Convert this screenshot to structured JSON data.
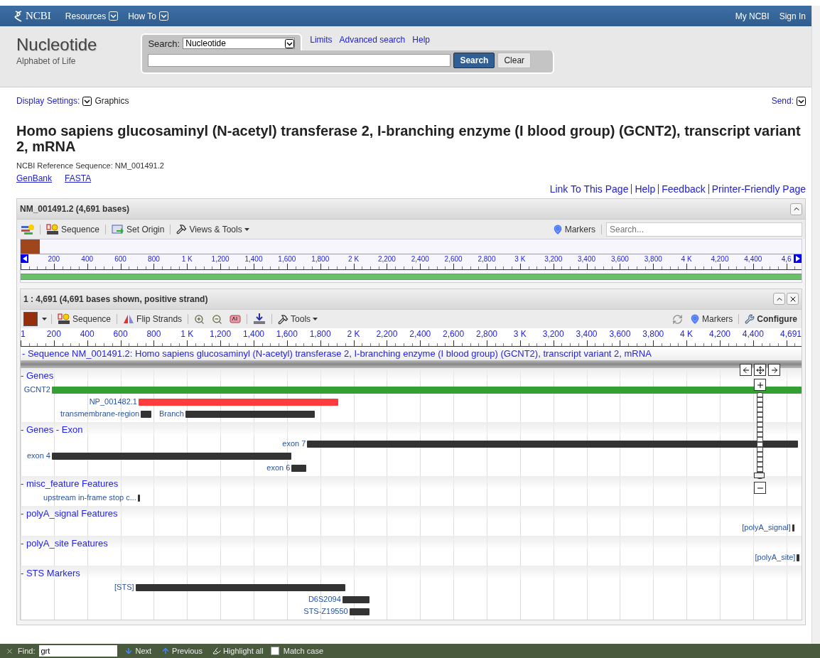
{
  "header": {
    "logo": "NCBI",
    "menus": [
      {
        "label": "Resources"
      },
      {
        "label": "How To"
      }
    ],
    "account_links": [
      "My NCBI",
      "Sign In"
    ]
  },
  "search": {
    "database_title": "Nucleotide",
    "tagline": "Alphabet of Life",
    "label": "Search:",
    "database": "Nucleotide",
    "links": [
      "Limits",
      "Advanced search",
      "Help"
    ],
    "search_button": "Search",
    "clear_button": "Clear"
  },
  "display": {
    "settings_label": "Display Settings:",
    "format": "Graphics",
    "send_label": "Send:"
  },
  "record": {
    "title": "Homo sapiens glucosaminyl (N-acetyl) transferase 2, I-branching enzyme (I blood group) (GCNT2), transcript variant 2, mRNA",
    "refseq": "NCBI Reference Sequence: NM_001491.2",
    "format_links": [
      "GenBank",
      "FASTA"
    ],
    "page_links": [
      "Link To This Page",
      "Help",
      "Feedback",
      "Printer-Friendly Page"
    ]
  },
  "viewer": {
    "title": "NM_001491.2 (4,691 bases)",
    "toolbar": {
      "sequence": "Sequence",
      "set_origin": "Set Origin",
      "views_tools": "Views & Tools",
      "markers": "Markers",
      "search_placeholder": "Search..."
    },
    "overview_ticks": [
      "200",
      "400",
      "600",
      "800",
      "1 K",
      "1,200",
      "1,400",
      "1,600",
      "1,800",
      "2 K",
      "2,200",
      "2,400",
      "2,600",
      "2,800",
      "3 K",
      "3,200",
      "3,400",
      "3,600",
      "3,800",
      "4 K",
      "4,200",
      "4,400",
      "4,6"
    ],
    "panel": {
      "title": "1 : 4,691 (4,691 bases shown, positive strand)",
      "toolbar": {
        "sequence": "Sequence",
        "flip_strands": "Flip Strands",
        "tools": "Tools",
        "markers": "Markers",
        "configure": "Configure"
      },
      "ruler_ticks": [
        "1",
        "200",
        "400",
        "600",
        "800",
        "1 K",
        "1,200",
        "1,400",
        "1,600",
        "1,800",
        "2 K",
        "2,200",
        "2,400",
        "2,600",
        "2,800",
        "3 K",
        "3,200",
        "3,400",
        "3,600",
        "3,800",
        "4 K",
        "4,200",
        "4,400",
        "4,691"
      ],
      "sequence_title": "- Sequence NM_001491.2: Homo sapiens glucosaminyl (N-acetyl) transferase 2, I-branching enzyme (I blood group) (GCNT2), transcript variant 2, mRNA",
      "zoom_slider": {
        "level": 0
      },
      "tracks": [
        {
          "title": "- Genes",
          "rows": [
            [
              {
                "label": "GCNT2",
                "color": "#33a033"
              }
            ],
            [
              {
                "label": "NP_001482.1",
                "color": "#ff3b3b"
              }
            ],
            [
              {
                "label": "transmembrane-region",
                "color": "#333333"
              },
              {
                "label": "Branch",
                "color": "#333333"
              }
            ]
          ]
        },
        {
          "title": "- Genes - Exon",
          "rows": [
            [
              {
                "label": "exon 7",
                "color": "#333333"
              }
            ],
            [
              {
                "label": "exon 4",
                "color": "#333333"
              }
            ],
            [
              {
                "label": "exon 6",
                "color": "#333333"
              }
            ]
          ]
        },
        {
          "title": "- misc_feature Features",
          "rows": [
            [
              {
                "label": "upstream in-frame stop c...",
                "color": "#333333"
              }
            ]
          ]
        },
        {
          "title": "- polyA_signal Features",
          "rows": [
            [
              {
                "label": "[polyA_signal]",
                "color": "#333333"
              }
            ]
          ]
        },
        {
          "title": "- polyA_site Features",
          "rows": [
            [
              {
                "label": "[polyA_site]",
                "color": "#333333"
              }
            ]
          ]
        },
        {
          "title": "- STS Markers",
          "rows": [
            [
              {
                "label": "[STS]",
                "color": "#333333"
              }
            ],
            [
              {
                "label": "D6S2094",
                "color": "#333333"
              }
            ],
            [
              {
                "label": "STS-Z19550",
                "color": "#333333"
              }
            ]
          ]
        }
      ]
    }
  },
  "find_bar": {
    "label": "Find:",
    "query": "grt",
    "next": "Next",
    "previous": "Previous",
    "highlight": "Highlight all",
    "match_case": {
      "label": "Match case",
      "checked": false
    }
  }
}
